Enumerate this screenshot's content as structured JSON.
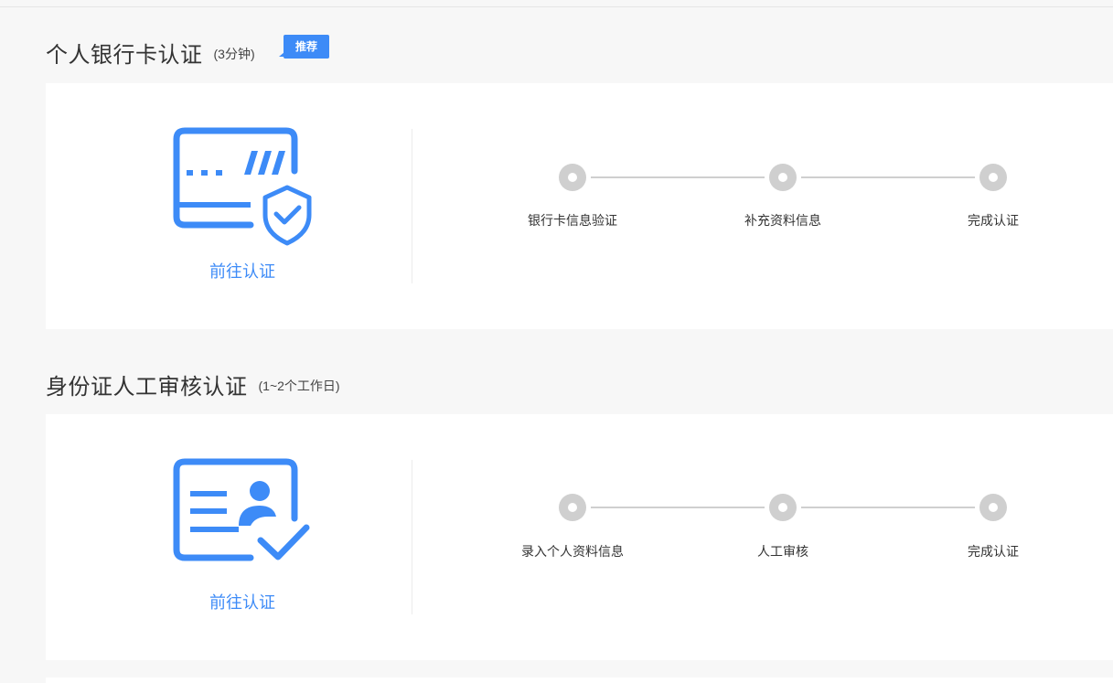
{
  "sections": [
    {
      "title": "个人银行卡认证",
      "duration": "(3分钟)",
      "badge": "推荐",
      "action_label": "前往认证",
      "icon": "bank-card-shield-icon",
      "steps": [
        "银行卡信息验证",
        "补充资料信息",
        "完成认证"
      ]
    },
    {
      "title": "身份证人工审核认证",
      "duration": "(1~2个工作日)",
      "action_label": "前往认证",
      "icon": "id-card-check-icon",
      "steps": [
        "录入个人资料信息",
        "人工审核",
        "完成认证"
      ]
    }
  ],
  "colors": {
    "accent": "#3d8bf7",
    "step_inactive": "#cfcfcf",
    "background": "#f7f7f7",
    "card": "#ffffff"
  }
}
